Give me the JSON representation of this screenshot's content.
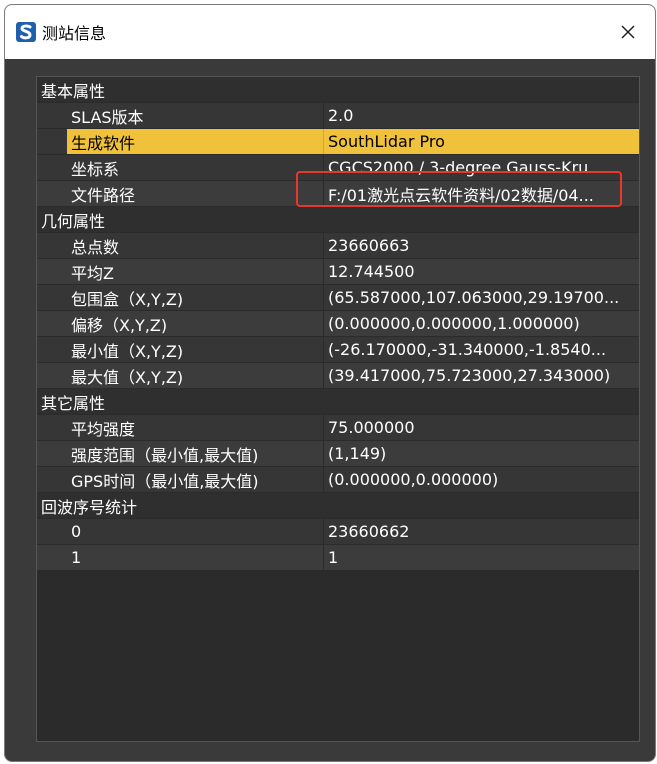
{
  "window": {
    "title": "测站信息",
    "icon_letter": "S"
  },
  "groups": [
    {
      "label": "基本属性",
      "rows": [
        {
          "key": "SLAS版本",
          "value": "2.0"
        },
        {
          "key": "生成软件",
          "value": "SouthLidar Pro",
          "selected": true
        },
        {
          "key": "坐标系",
          "value": "CGCS2000 / 3-degree Gauss-Kru..."
        },
        {
          "key": "文件路径",
          "value": "F:/01激光点云软件资料/02数据/04..."
        }
      ]
    },
    {
      "label": "几何属性",
      "rows": [
        {
          "key": "总点数",
          "value": "23660663"
        },
        {
          "key": "平均Z",
          "value": "12.744500"
        },
        {
          "key": "包围盒（X,Y,Z)",
          "value": "(65.587000,107.063000,29.19700..."
        },
        {
          "key": "偏移（X,Y,Z)",
          "value": "(0.000000,0.000000,1.000000)"
        },
        {
          "key": "最小值（X,Y,Z)",
          "value": "(-26.170000,-31.340000,-1.8540..."
        },
        {
          "key": "最大值（X,Y,Z)",
          "value": "(39.417000,75.723000,27.343000)"
        }
      ]
    },
    {
      "label": "其它属性",
      "rows": [
        {
          "key": "平均强度",
          "value": "75.000000"
        },
        {
          "key": "强度范围（最小值,最大值)",
          "value": "(1,149)"
        },
        {
          "key": "GPS时间（最小值,最大值)",
          "value": "(0.000000,0.000000)"
        }
      ]
    },
    {
      "label": "回波序号统计",
      "rows": [
        {
          "key": "0",
          "value": "23660662"
        },
        {
          "key": "1",
          "value": "1"
        }
      ]
    }
  ],
  "colors": {
    "selected_row": "#f0c13a",
    "highlight_border": "#e8372b",
    "panel_bg": "#2b2b2b"
  }
}
